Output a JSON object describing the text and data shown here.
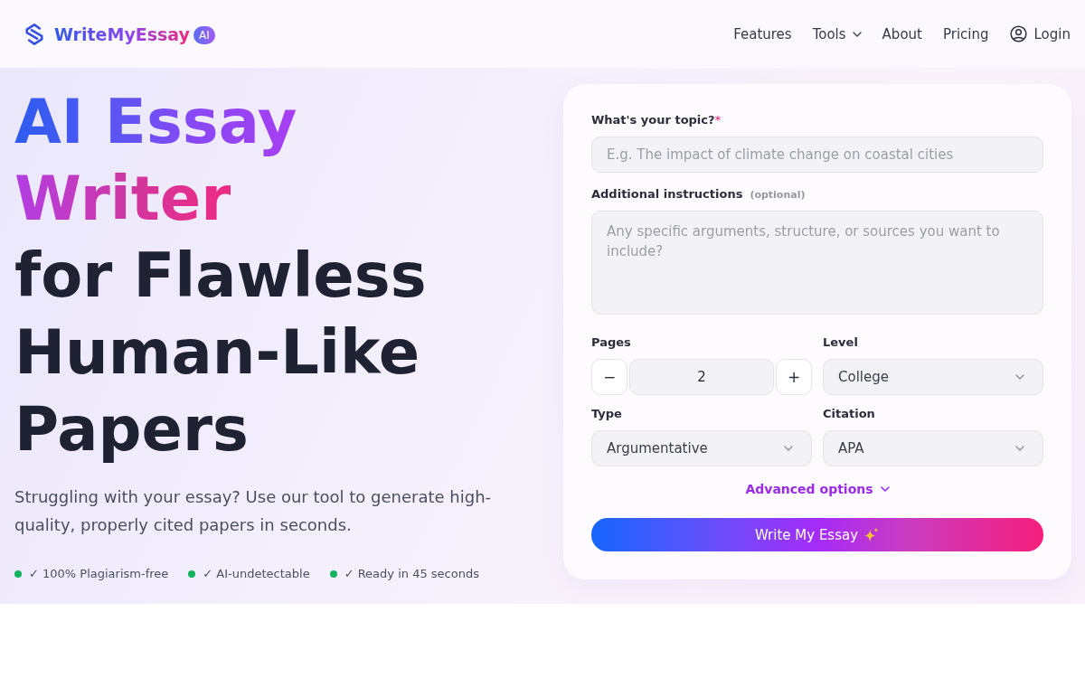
{
  "header": {
    "brand": {
      "name": "WriteMyEssay",
      "badge": "AI"
    },
    "nav": [
      {
        "label": "Features",
        "kind": "link"
      },
      {
        "label": "Tools",
        "kind": "menu"
      },
      {
        "label": "About",
        "kind": "link"
      },
      {
        "label": "Pricing",
        "kind": "link"
      },
      {
        "label": "Login",
        "kind": "account"
      }
    ]
  },
  "hero": {
    "headline": [
      {
        "text": "AI Essay",
        "highlight": true
      },
      {
        "text": "Writer",
        "highlight": true
      },
      {
        "text": "for Flawless",
        "highlight": false
      },
      {
        "text": "Human-Like",
        "highlight": false
      },
      {
        "text": "Papers",
        "highlight": false
      }
    ],
    "subtitle": "Struggling with your essay? Use our tool to generate high-quality, properly cited papers in seconds.",
    "features": [
      "✓ 100% Plagiarism-free",
      "✓ AI-undetectable",
      "✓ Ready in 45 seconds"
    ]
  },
  "form": {
    "topic": {
      "label": "What's your topic?",
      "required_mark": "*",
      "placeholder": "E.g. The impact of climate change on coastal cities"
    },
    "instructions": {
      "label": "Additional instructions",
      "hint": "(optional)",
      "placeholder": "Any specific arguments, structure, or sources you want to include?"
    },
    "fields": [
      {
        "label": "Pages",
        "kind": "stepper",
        "value": "2",
        "decrement": "−",
        "increment": "+"
      },
      {
        "label": "Level",
        "kind": "select",
        "value": "College"
      },
      {
        "label": "Type",
        "kind": "select",
        "value": "Argumentative"
      },
      {
        "label": "Citation",
        "kind": "select",
        "value": "APA"
      }
    ],
    "advanced": {
      "label": "Advanced options",
      "expanded": false
    },
    "submit": {
      "label": "Write My Essay"
    }
  }
}
